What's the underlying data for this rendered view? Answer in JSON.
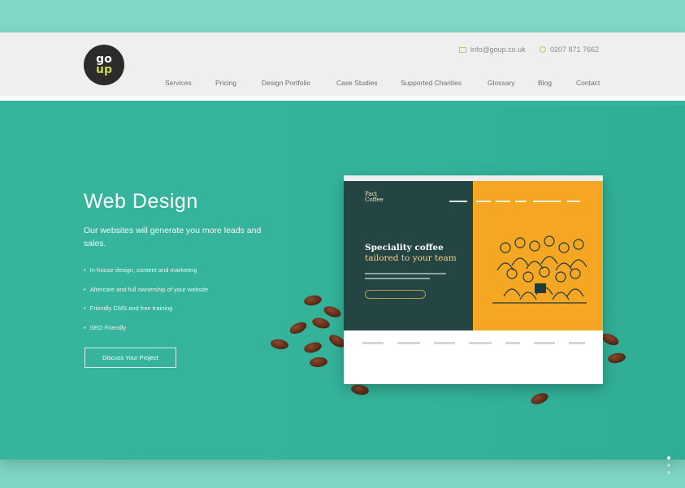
{
  "header": {
    "logo_top": "go",
    "logo_bottom": "up",
    "email": "info@goup.co.uk",
    "phone": "0207 871 7662",
    "nav": [
      "Services",
      "Pricing",
      "Design Portfolio",
      "Case Studies",
      "Supported Charities",
      "Glossary",
      "Blog",
      "Contact"
    ]
  },
  "hero": {
    "title": "Web Design",
    "subtitle": "Our websites will generate you more leads and sales.",
    "bullets": [
      "In-house design, content and marketing",
      "Aftercare and full ownership of your website",
      "Friendly CMS and free training",
      "SEO Friendly"
    ],
    "cta": "Discuss Your Project"
  },
  "mockup": {
    "brand_line1": "Pact",
    "brand_line2": "Coffee",
    "headline_1": "Speciality coffee",
    "headline_2": "tailored to your team"
  },
  "colors": {
    "page_bg": "#7ed8c5",
    "hero": "#35b39b",
    "topbar": "#efefef",
    "accent": "#c9d94b",
    "mock_dark": "#254544",
    "mock_orange": "#f5a623"
  },
  "slider": {
    "count": 3,
    "active_index": 0
  }
}
